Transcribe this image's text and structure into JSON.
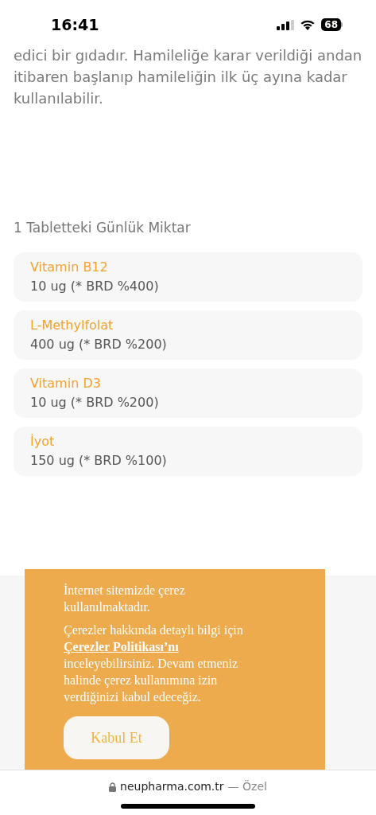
{
  "status_bar": {
    "time": "16:41",
    "battery": "68"
  },
  "intro": {
    "lines": [
      "edici bir gıdadır. Hamileliğe karar verildiği andan",
      "itibaren başlanıp hamileliğin ilk üç ayına kadar",
      "kullanılabilir."
    ]
  },
  "section_title": "1 Tabletteki Günlük Miktar",
  "nutrients": [
    {
      "name": "Vitamin B12",
      "amount": "10 ug (* BRD %400)"
    },
    {
      "name": "L-Methylfolat",
      "amount": "400 ug (* BRD %200)"
    },
    {
      "name": "Vitamin D3",
      "amount": "10 ug (* BRD %200)"
    },
    {
      "name": "İyot",
      "amount": "150 ug (* BRD %100)"
    }
  ],
  "cookie_banner": {
    "notice": "İnternet sitemizde çerez kullanılmaktadır.",
    "text_before": "Çerezler hakkında detaylı bilgi için",
    "link": "Çerezler Politikası’nı",
    "text_after": "inceleyebilirsiniz. Devam etmeniz halinde çerez kullanımına izin verdiğinizi kabul edeceğiz.",
    "button": "Kabul Et"
  },
  "browser_bar": {
    "url": "neupharma.com.tr",
    "mode": "— Özel"
  }
}
